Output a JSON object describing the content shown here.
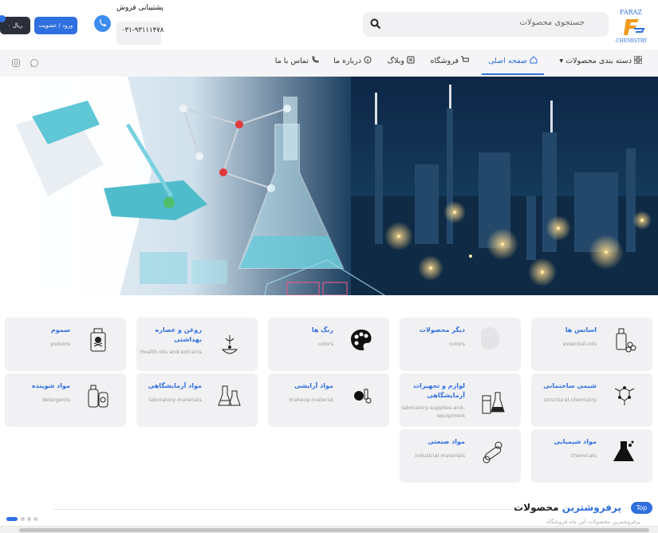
{
  "header": {
    "logo_text_top": "FARAZ",
    "logo_text_bottom": "CHEMISTRY",
    "search_placeholder": "جستجوی محصولات",
    "support_title": "پشتیبانی فروش",
    "support_phone": "۰۳۱-۹۳۱۱۱۴۷۸",
    "login_label": "ورود / عضویت",
    "cart_label": "۰ ریال"
  },
  "nav": {
    "items": [
      {
        "label": "دسته بندی محصولات",
        "icon": "grid-icon"
      },
      {
        "label": "صفحه اصلی",
        "icon": "home-icon",
        "active": true
      },
      {
        "label": "فروشگاه",
        "icon": "cart-icon"
      },
      {
        "label": "وبلاگ",
        "icon": "blog-icon"
      },
      {
        "label": "درباره ما",
        "icon": "info-icon"
      },
      {
        "label": "تماس با ما",
        "icon": "phone-icon"
      }
    ],
    "social": [
      "instagram-icon",
      "whatsapp-icon"
    ]
  },
  "categories": [
    {
      "title": "اسانس ها",
      "subtitle": "essential-oils",
      "icon": "essence-icon"
    },
    {
      "title": "دیگر محصولات",
      "subtitle": "colors",
      "icon": "placeholder-icon"
    },
    {
      "title": "رنگ ها",
      "subtitle": "colors",
      "icon": "palette-icon"
    },
    {
      "title": "روغن و عصاره بهداشتی",
      "subtitle": "Health oils and extracts",
      "icon": "oil-icon"
    },
    {
      "title": "سموم",
      "subtitle": "poisons",
      "icon": "poison-icon"
    },
    {
      "title": "شیمی ساختمانی",
      "subtitle": "structural-chemistry",
      "icon": "molecule-icon"
    },
    {
      "title": "لوازم و تجهیزات آزمایشگاهی",
      "subtitle": "laboratory-supplies-and-equipment",
      "icon": "lab-equipment-icon"
    },
    {
      "title": "مواد آرایشی",
      "subtitle": "makeup-material",
      "icon": "makeup-icon"
    },
    {
      "title": "مواد آزمایشگاهی",
      "subtitle": "laboratory-materials",
      "icon": "flasks-icon"
    },
    {
      "title": "مواد شوینده",
      "subtitle": "detergents",
      "icon": "detergent-icon"
    },
    {
      "title": "مواد شیمیایی",
      "subtitle": "chemicals",
      "icon": "chemical-flask-icon"
    },
    {
      "title": "مواد صنعتی",
      "subtitle": "industrial materials",
      "icon": "industrial-icon"
    }
  ],
  "bestsellers": {
    "badge": "Top",
    "title_accent": "پرفروشترین",
    "title_rest": "محصولات",
    "subtitle": "پرفروشترین محصولات این ماه فروشگاه"
  },
  "colors": {
    "accent": "#2f6fe0",
    "dark": "#2b2f3a",
    "card_bg": "#f1f1f3"
  }
}
